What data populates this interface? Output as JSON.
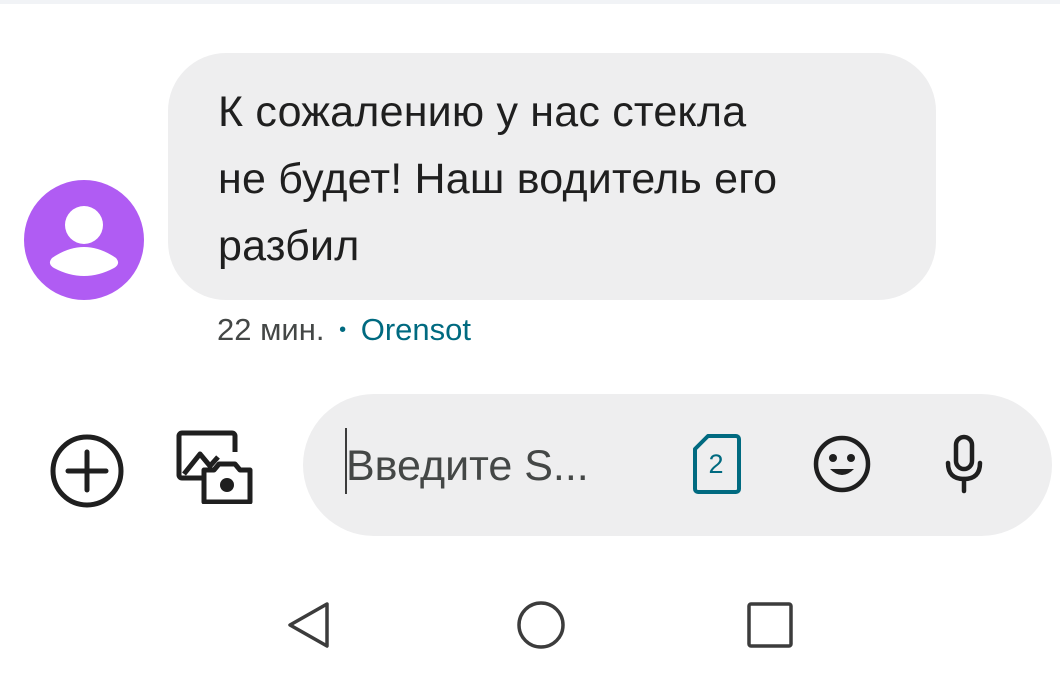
{
  "message": {
    "lines": [
      "К сожалению у нас стекла",
      "не будет! Наш водитель его",
      "разбил"
    ],
    "time": "22 мин.",
    "separator": "•",
    "sim_name": "Orensot"
  },
  "compose": {
    "placeholder": "Введите S...",
    "sim_slot": "2"
  },
  "icons": {
    "avatar": "person-icon",
    "add": "add-circle-icon",
    "gallery": "gallery-camera-icon",
    "sim": "sim-card-icon",
    "emoji": "emoji-icon",
    "mic": "microphone-icon",
    "back": "back-triangle-icon",
    "home": "home-circle-icon",
    "recents": "recents-square-icon"
  },
  "colors": {
    "avatar": "#b05cf3",
    "bubble": "#eeeeef",
    "accent": "#006a80",
    "text": "#1f1f1f"
  }
}
